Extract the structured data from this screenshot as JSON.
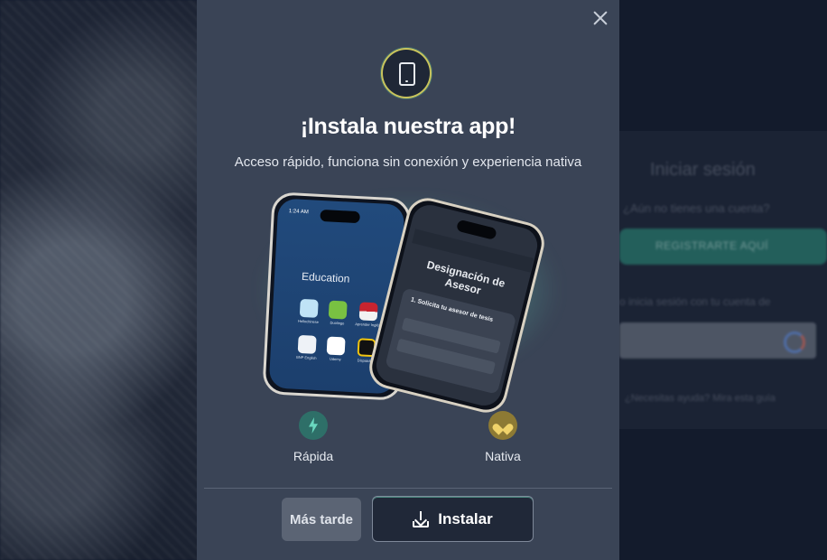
{
  "background": {
    "login_title": "Iniciar sesión",
    "login_subtitle": "¿Aún no tienes una cuenta?",
    "register_button": "REGISTRARTE AQUÍ",
    "alt_login_text": "o inicia sesión con tu cuenta de",
    "help_text": "¿Necesitas ayuda? Mira esta guía"
  },
  "modal": {
    "title": "¡Instala nuestra app!",
    "subtitle": "Acceso rápido, funciona sin conexión y experiencia nativa",
    "illustration": {
      "phone_a": {
        "time": "1:24 AM",
        "folder_title": "Education",
        "apps": [
          "Hellochinese",
          "Duolingo",
          "Aprender Inglés",
          "BNP English",
          "Udemy",
          "Dispatcher"
        ]
      },
      "phone_b": {
        "heading": "Designación de Asesor",
        "step": "1. Solicita tu asesor de tesis"
      }
    },
    "features": [
      {
        "label": "Rápida",
        "icon": "bolt-icon",
        "color": "#2e6f68"
      },
      {
        "label": "Nativa",
        "icon": "heart-icon",
        "color": "#8d7a34"
      }
    ],
    "buttons": {
      "later": "Más tarde",
      "install": "Instalar"
    }
  },
  "colors": {
    "modal_bg": "#3a4456",
    "accent": "#5fdcbe",
    "install_bg": "#202838"
  }
}
